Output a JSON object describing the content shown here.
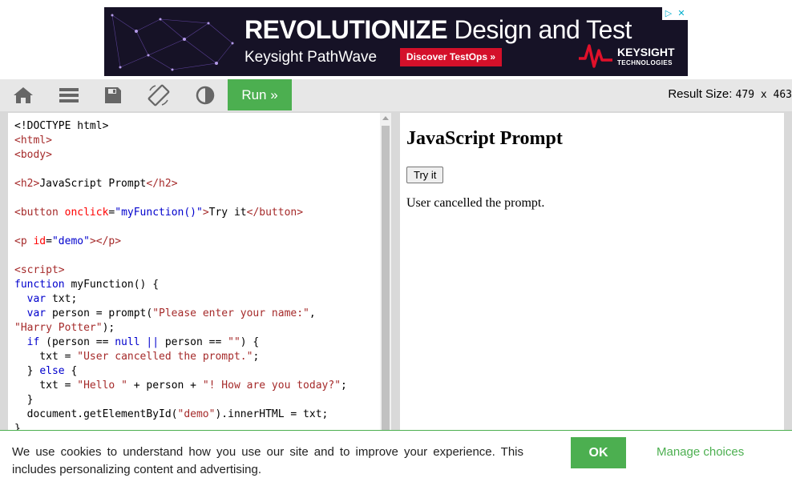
{
  "ad": {
    "headline_bold": "REVOLUTIONIZE",
    "headline_light": " Design and Test",
    "subline": "Keysight PathWave",
    "cta": "Discover TestOps »",
    "brand_name": "KEYSIGHT",
    "brand_sub": "TECHNOLOGIES",
    "adchoices_icon": "▷",
    "close_icon": "✕"
  },
  "toolbar": {
    "run_label": "Run »",
    "result_size_label": "Result Size: ",
    "result_size_value": "479 x 463"
  },
  "code": {
    "lines": [
      "<!DOCTYPE html>",
      "<html>",
      "<body>",
      "",
      "<h2>JavaScript Prompt</h2>",
      "",
      "<button onclick=\"myFunction()\">Try it</button>",
      "",
      "<p id=\"demo\"></p>",
      "",
      "<script>",
      "function myFunction() {",
      "  var txt;",
      "  var person = prompt(\"Please enter your name:\",",
      "\"Harry Potter\");",
      "  if (person == null || person == \"\") {",
      "    txt = \"User cancelled the prompt.\";",
      "  } else {",
      "    txt = \"Hello \" + person + \"! How are you today?\";",
      "  }",
      "  document.getElementById(\"demo\").innerHTML = txt;",
      "}"
    ]
  },
  "result": {
    "heading": "JavaScript Prompt",
    "button_label": "Try it",
    "demo_text": "User cancelled the prompt."
  },
  "cookie": {
    "text": "We use cookies to understand how you use our site and to improve your experience. This includes personalizing content and advertising.",
    "ok_label": "OK",
    "manage_label": "Manage choices"
  },
  "colors": {
    "accent": "#4caf50",
    "toolbar_bg": "#e7e7e7",
    "ad_bg": "#161226",
    "ad_cta": "#d4102a"
  }
}
